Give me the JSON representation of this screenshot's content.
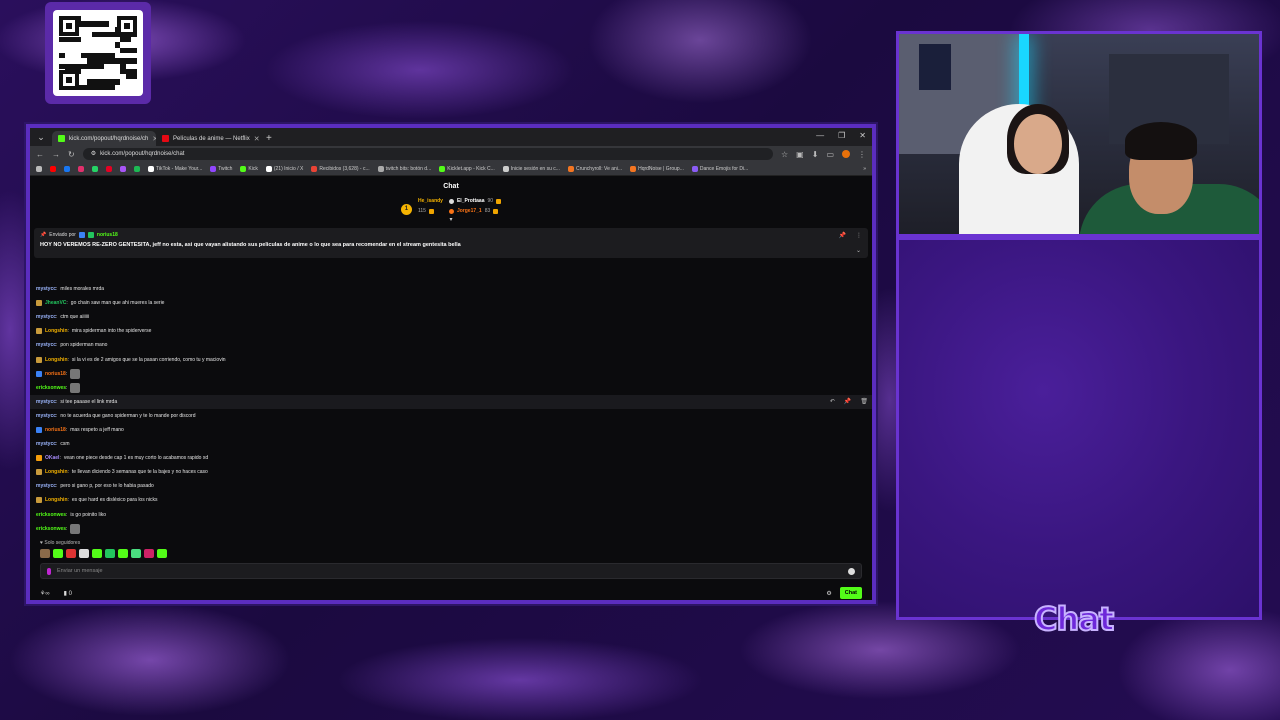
{
  "browser": {
    "tabs": [
      {
        "title": "kick.com/popout/hqrdnoise/ch",
        "favicon_color": "#53fc18",
        "active": true
      },
      {
        "title": "Películas de anime — Netflix",
        "favicon_color": "#e50914",
        "active": false
      }
    ],
    "url": "kick.com/popout/hqrdnoise/chat",
    "bookmarks": [
      {
        "label": "TikTok - Make Your...",
        "color": "#ffffff"
      },
      {
        "label": "Twitch",
        "color": "#9146ff"
      },
      {
        "label": "Kick",
        "color": "#53fc18"
      },
      {
        "label": "(21) Inicio / X",
        "color": "#ffffff"
      },
      {
        "label": "Recibidos (3,628) - c...",
        "color": "#ea4335"
      },
      {
        "label": "twitch bits: botón d...",
        "color": "#aaaaaa"
      },
      {
        "label": "Kicklet.app - Kick C...",
        "color": "#53fc18"
      },
      {
        "label": "Inicie sesión en su c...",
        "color": "#cccccc"
      },
      {
        "label": "Crunchyroll: Ve ani...",
        "color": "#f47521"
      },
      {
        "label": "HqrdNoise | Group...",
        "color": "#f47521"
      },
      {
        "label": "Dance Emojis for Di...",
        "color": "#8b5cf6"
      }
    ]
  },
  "chat": {
    "title": "Chat",
    "gifters": [
      {
        "name": "He_isandy",
        "count": "115",
        "color": "#f5b301"
      },
      {
        "name": "El_Prottaaa",
        "count": "90",
        "color": "#ffffff"
      },
      {
        "name": "Jorge17_1",
        "count": "83",
        "color": "#f97316"
      }
    ],
    "pinned": {
      "label": "Enviado por",
      "user": "norius18",
      "text": "HOY NO VEREMOS RE-ZERO GENTESITA, jeff no esta, asi que vayan alistando sus peliculas de anime o lo que sea para recomendar en el stream gentesita bella"
    },
    "messages": [
      {
        "user": "mystycc",
        "color": "#9db7ff",
        "text": "miles morales mrda",
        "badge": ""
      },
      {
        "user": "JheanVC",
        "color": "#22c55e",
        "text": "go chain saw man que ahi mueres la serie",
        "badge": "#c89b3c"
      },
      {
        "user": "mystycc",
        "color": "#9db7ff",
        "text": "ctm que aiiiiii",
        "badge": ""
      },
      {
        "user": "Longshin",
        "color": "#f5b301",
        "text": "mira spiderman into the spiderverse",
        "badge": "#c89b3c"
      },
      {
        "user": "mystycc",
        "color": "#9db7ff",
        "text": "pon spiderman mano",
        "badge": ""
      },
      {
        "user": "Longshin",
        "color": "#f5b301",
        "text": "si la vi es de 2 amigos que se la pasan corriendo, como tu y maciovin",
        "badge": "#c89b3c"
      },
      {
        "user": "norius18",
        "color": "#f97316",
        "text": "",
        "badge": "#3b82f6",
        "emote": true
      },
      {
        "user": "ericksonwes",
        "color": "#53fc18",
        "text": "",
        "badge": "",
        "emote": true
      },
      {
        "user": "mystycc",
        "color": "#9db7ff",
        "text": "si tee paaase el link mrda",
        "badge": "",
        "highlight": true
      },
      {
        "user": "mystycc",
        "color": "#9db7ff",
        "text": "no te acuerda que gano spiderman y te lo mande por discord",
        "badge": ""
      },
      {
        "user": "norius18",
        "color": "#f97316",
        "text": "mas respeto a jeff mano",
        "badge": "#3b82f6"
      },
      {
        "user": "mystycc",
        "color": "#9db7ff",
        "text": "csm",
        "badge": ""
      },
      {
        "user": "OKael",
        "color": "#a78bfa",
        "text": "vean one piece desde cap 1 es muy corto lo acabamos rapido xd",
        "badge": "#f59e0b"
      },
      {
        "user": "Longshin",
        "color": "#f5b301",
        "text": "te llevan diciendo 3 semanas que te la bajes y no haces caso",
        "badge": "#c89b3c"
      },
      {
        "user": "mystycc",
        "color": "#9db7ff",
        "text": "pero si gano p, por eso te lo habia pasado",
        "badge": ""
      },
      {
        "user": "Longshin",
        "color": "#f5b301",
        "text": "es que hard es disléxico para los nicks",
        "badge": "#c89b3c"
      },
      {
        "user": "ericksonwes",
        "color": "#53fc18",
        "text": "is go poinito liko",
        "badge": ""
      },
      {
        "user": "ericksonwes",
        "color": "#53fc18",
        "text": "",
        "badge": "",
        "emote": true
      }
    ],
    "followers_only": "Solo seguidores",
    "input_placeholder": "Enviar un mensaje",
    "viewer_count": "0",
    "send_label": "Chat"
  },
  "panel_label": "Chat"
}
